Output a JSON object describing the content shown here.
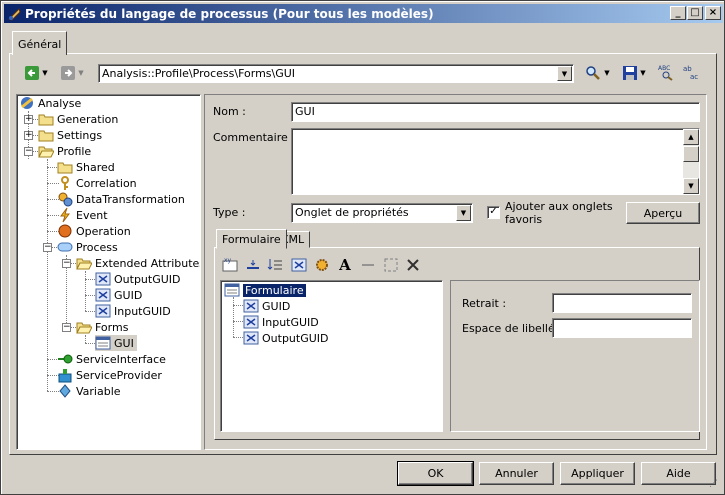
{
  "window": {
    "title": "Propriétés du langage de processus  (Pour tous les modèles)"
  },
  "tabs": {
    "general": "Général"
  },
  "toolbar": {
    "path": "Analysis::Profile\\Process\\Forms\\GUI"
  },
  "tree": [
    {
      "label": "Analyse",
      "icon": "analyse-icon"
    },
    {
      "label": "Generation",
      "icon": "folder-icon"
    },
    {
      "label": "Settings",
      "icon": "folder-icon"
    },
    {
      "label": "Profile",
      "icon": "folder-open-icon"
    },
    {
      "label": "Shared",
      "icon": "folder-icon"
    },
    {
      "label": "Correlation",
      "icon": "key-icon"
    },
    {
      "label": "DataTransformation",
      "icon": "gears-icon"
    },
    {
      "label": "Event",
      "icon": "event-icon"
    },
    {
      "label": "Operation",
      "icon": "operation-icon"
    },
    {
      "label": "Process",
      "icon": "process-icon"
    },
    {
      "label": "Extended Attributes",
      "icon": "folder-open-icon"
    },
    {
      "label": "OutputGUID",
      "icon": "attribute-icon"
    },
    {
      "label": "GUID",
      "icon": "attribute-icon"
    },
    {
      "label": "InputGUID",
      "icon": "attribute-icon"
    },
    {
      "label": "Forms",
      "icon": "folder-open-icon"
    },
    {
      "label": "GUI",
      "icon": "form-icon"
    },
    {
      "label": "ServiceInterface",
      "icon": "service-interface-icon"
    },
    {
      "label": "ServiceProvider",
      "icon": "service-provider-icon"
    },
    {
      "label": "Variable",
      "icon": "variable-icon"
    }
  ],
  "form": {
    "nom_label": "Nom :",
    "nom_value": "GUI",
    "commentaire_label": "Commentaire :",
    "commentaire_value": "",
    "type_label": "Type :",
    "type_value": "Onglet de propriétés",
    "ajouter_label_1": "Ajouter aux onglets",
    "ajouter_label_2": "favoris",
    "ajouter_checked": true,
    "apercu": "Aperçu"
  },
  "subtabs": {
    "formulaire": "Formulaire",
    "xml": "XML"
  },
  "formtree": {
    "root": "Formulaire",
    "items": [
      "GUID",
      "InputGUID",
      "OutputGUID"
    ]
  },
  "props": {
    "retrait_label": "Retrait :",
    "retrait_value": "",
    "espace_label": "Espace de libellé :",
    "espace_value": ""
  },
  "buttons": {
    "ok": "OK",
    "annuler": "Annuler",
    "appliquer": "Appliquer",
    "aide": "Aide"
  }
}
